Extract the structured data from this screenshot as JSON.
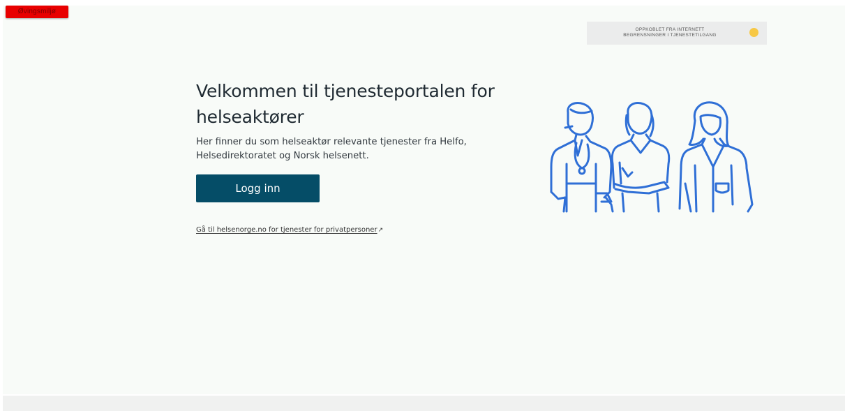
{
  "environment_badge": {
    "label": "Øvingsmiljø"
  },
  "status_banner": {
    "line1": "OPPKOBLET FRA INTERNETT",
    "line2": "BEGRENSNINGER I TJENESTETILGANG",
    "indicator_color": "#f7c845",
    "indicator_icon": "status-dot-icon"
  },
  "main": {
    "title": "Velkommen til tjenesteportalen for helseaktører",
    "intro": "Her finner du som helseaktør relevante tjenester fra Helfo, Helsedirektoratet og Norsk helsenett.",
    "login_button": "Logg inn",
    "private_link": "Gå til helsenorge.no for tjenester for privatpersoner",
    "private_link_icon": "external-link-icon"
  },
  "illustration": {
    "icon": "health-workers-illustration",
    "stroke_color": "#2f6fd6"
  },
  "colors": {
    "primary_button": "#054d67",
    "badge": "#e80000",
    "background": "#f8fbf8"
  }
}
